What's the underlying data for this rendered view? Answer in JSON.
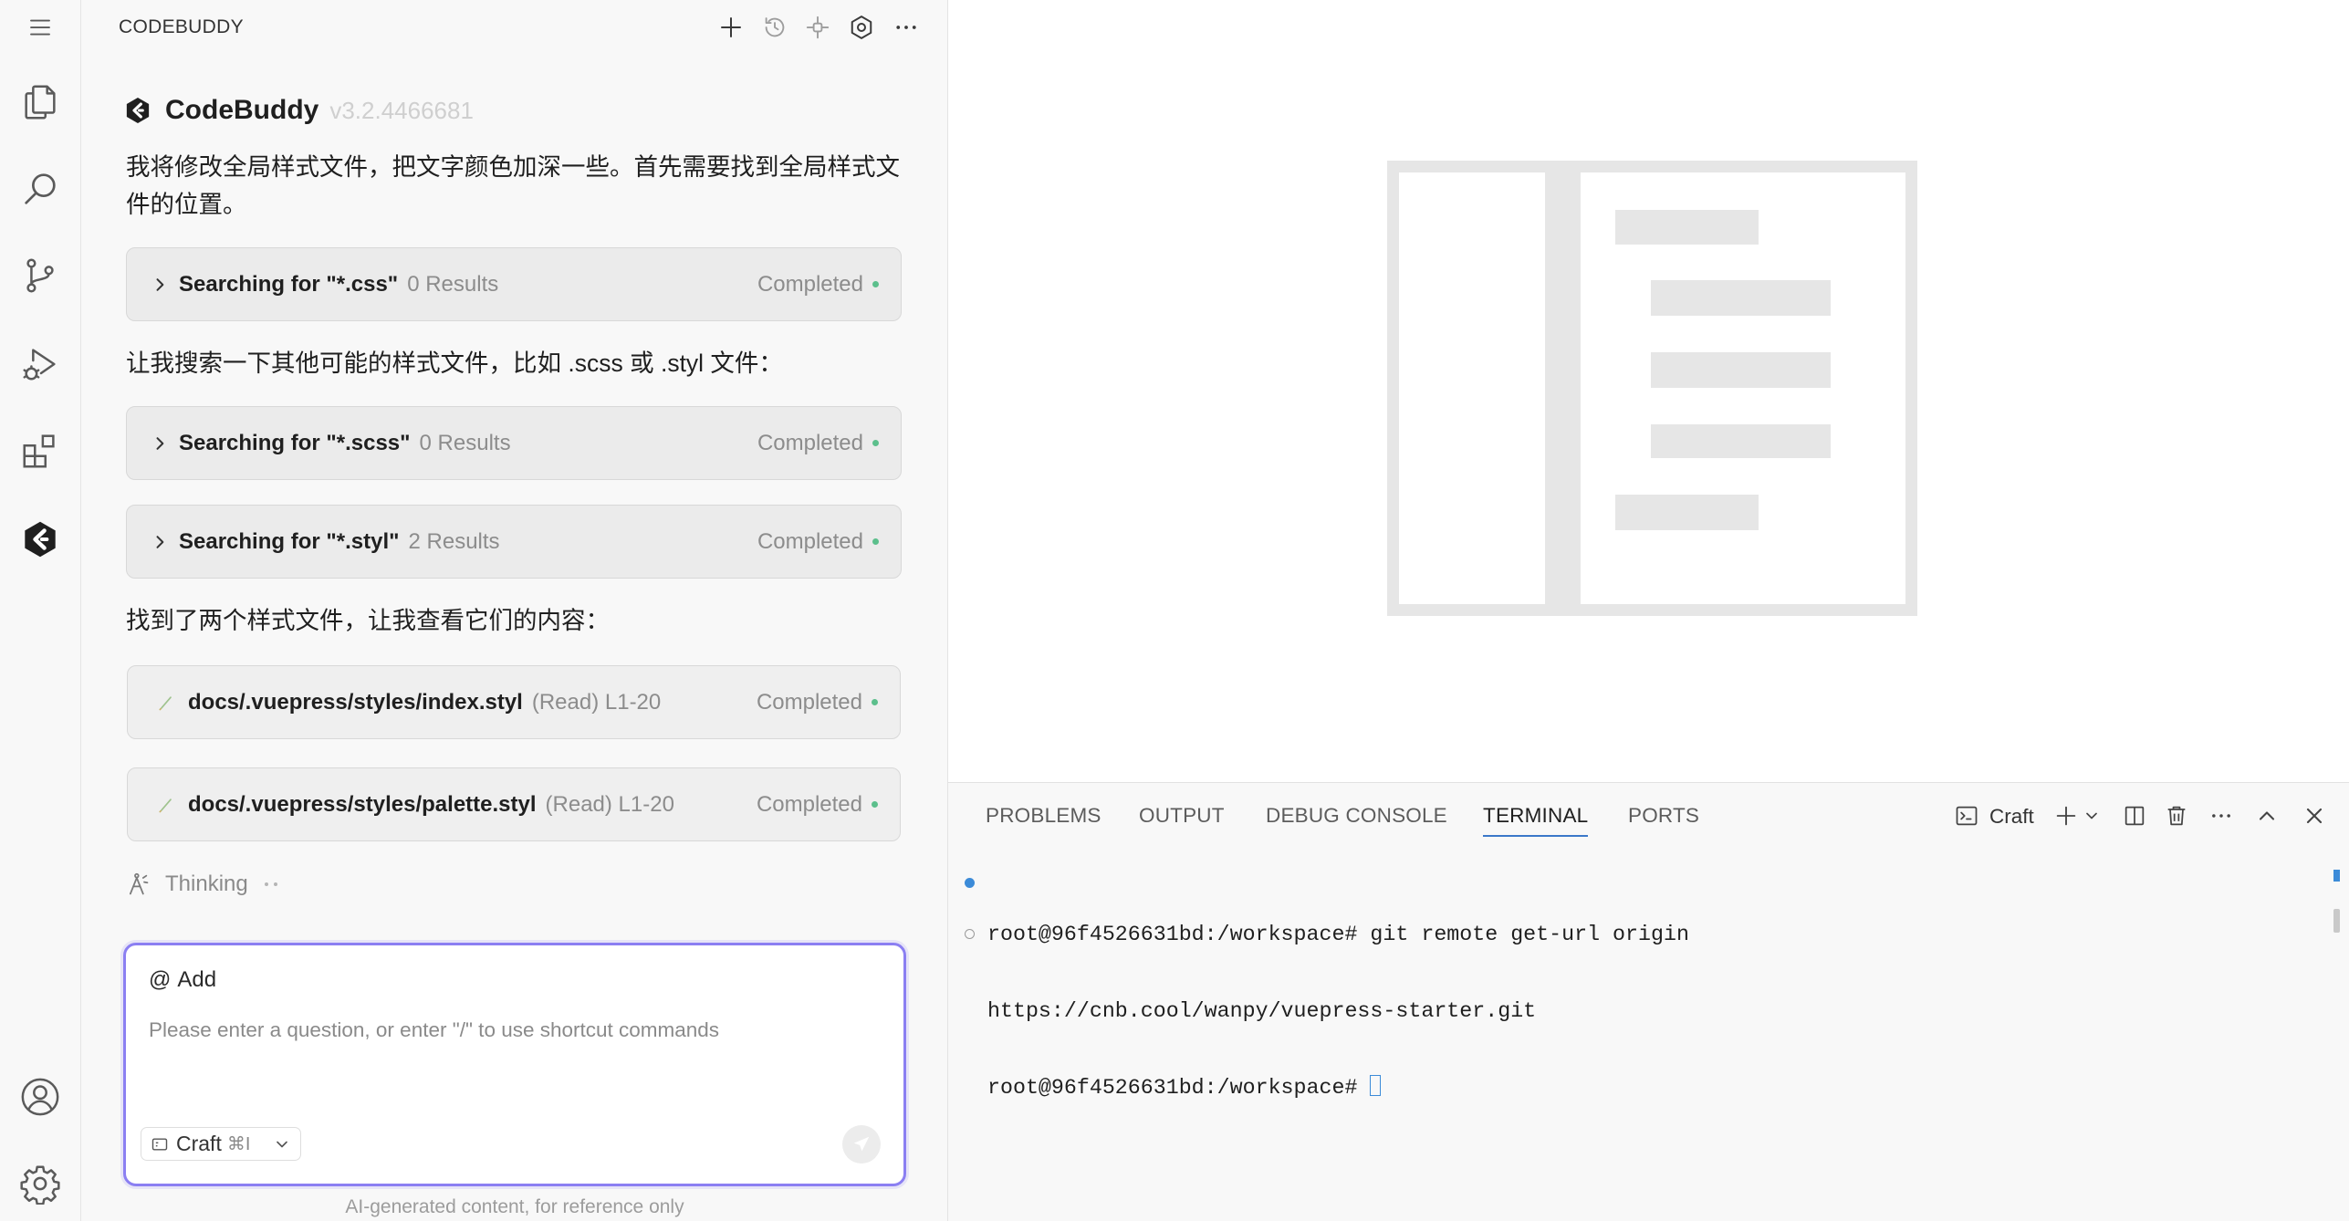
{
  "theme": {
    "accent": "#8b7ff2",
    "status_completed": "#5cbf8c",
    "terminal_dot": "#3c8bd8",
    "active_tab_underline": "#3b78c9"
  },
  "activity_bar": {
    "top_icons": [
      "menu-icon",
      "explorer-icon",
      "search-icon",
      "source-control-icon",
      "run-debug-icon",
      "extensions-icon",
      "codebuddy-icon"
    ],
    "bottom_icons": [
      "account-icon",
      "settings-icon"
    ]
  },
  "sidebar": {
    "title": "CODEBUDDY",
    "header_icons": [
      "plus-icon",
      "history-icon",
      "mcp-icon",
      "settings-icon",
      "more-icon"
    ],
    "app_name": "CodeBuddy",
    "version": "v3.2.4466681"
  },
  "chat": {
    "blocks": [
      {
        "text": "我将修改全局样式文件，把文字颜色加深一些。首先需要找到全局样式文件的位置。"
      },
      {
        "label": "Searching for \"*.css\"",
        "detail": "0 Results",
        "status": "Completed"
      },
      {
        "text": "让我搜索一下其他可能的样式文件，比如 .scss 或 .styl 文件："
      },
      {
        "label": "Searching for \"*.scss\"",
        "detail": "0 Results",
        "status": "Completed"
      },
      {
        "label": "Searching for \"*.styl\"",
        "detail": "2 Results",
        "status": "Completed"
      },
      {
        "text": "找到了两个样式文件，让我查看它们的内容："
      },
      {
        "label": "docs/.vuepress/styles/index.styl",
        "detail": "(Read) L1-20",
        "status": "Completed"
      },
      {
        "label": "docs/.vuepress/styles/palette.styl",
        "detail": "(Read) L1-20",
        "status": "Completed"
      }
    ],
    "thinking": "Thinking"
  },
  "composer": {
    "context_symbol": "@",
    "context_label": "Add",
    "placeholder": "Please enter a question, or enter \"/\" to use shortcut commands",
    "mode": "Craft",
    "mode_shortcut": "⌘I",
    "footer": "AI-generated content, for reference only"
  },
  "panel": {
    "tabs": [
      {
        "label": "PROBLEMS",
        "active": false
      },
      {
        "label": "OUTPUT",
        "active": false
      },
      {
        "label": "DEBUG CONSOLE",
        "active": false
      },
      {
        "label": "TERMINAL",
        "active": true
      },
      {
        "label": "PORTS",
        "active": false
      }
    ],
    "terminal_profile": "Craft",
    "terminal_lines": [
      "root@96f4526631bd:/workspace# git remote get-url origin",
      "https://cnb.cool/wanpy/vuepress-starter.git",
      "root@96f4526631bd:/workspace# "
    ]
  }
}
